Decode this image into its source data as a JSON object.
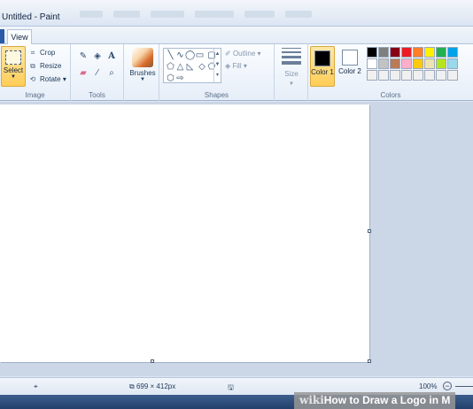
{
  "window": {
    "title": "Untitled - Paint"
  },
  "tabs": [
    {
      "label": "View"
    }
  ],
  "ribbon": {
    "image": {
      "select_label": "Select",
      "crop_label": "Crop",
      "resize_label": "Resize",
      "rotate_label": "Rotate",
      "group_label": "Image"
    },
    "tools": {
      "items": [
        "pencil-icon",
        "fill-icon",
        "text-icon",
        "eraser-icon",
        "color-picker-icon",
        "magnifier-icon"
      ],
      "group_label": "Tools"
    },
    "brushes": {
      "label": "Brushes"
    },
    "shapes": {
      "outline_label": "Outline",
      "fill_label": "Fill",
      "group_label": "Shapes"
    },
    "size": {
      "label": "Size"
    },
    "colors": {
      "color1_label": "Color 1",
      "color2_label": "Color 2",
      "color1_value": "#000000",
      "color2_value": "#ffffff",
      "palette": [
        "#000000",
        "#7f7f7f",
        "#880015",
        "#ed1c24",
        "#ff7f27",
        "#fff200",
        "#22b14c",
        "#00a2e8",
        "#ffffff",
        "#c3c3c3",
        "#b97a57",
        "#ffaec9",
        "#ffc90e",
        "#efe4b0",
        "#b5e61d",
        "#99d9ea",
        "#f0f0f0",
        "#f0f0f0",
        "#f0f0f0",
        "#f0f0f0",
        "#f0f0f0",
        "#f0f0f0",
        "#f0f0f0",
        "#f0f0f0"
      ],
      "group_label": "Colors"
    }
  },
  "status": {
    "dimensions": "699 × 412px",
    "zoom": "100%"
  },
  "watermark": {
    "wiki": "wiki",
    "text": "How to Draw a Logo in M"
  }
}
